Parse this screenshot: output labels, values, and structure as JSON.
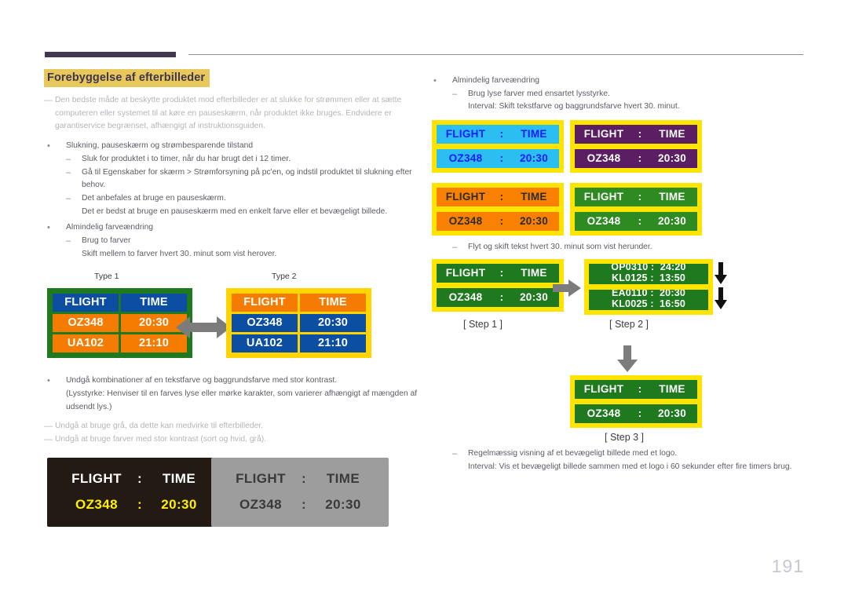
{
  "page": {
    "number": "191"
  },
  "header": {
    "accent_color": "#41374f",
    "rule_color": "#8e8e93"
  },
  "left": {
    "title": "Forebyggelse af efterbilleder",
    "intro": "Den bedste måde at beskytte produktet mod efterbilleder er at slukke for strømmen eller at sætte computeren eller systemet til at køre en pauseskærm, når produktet ikke bruges. Endvidere er garantiservice begrænset, afhængigt af instruktionsguiden.",
    "b1": "Slukning, pauseskærm og strømbesparende tilstand",
    "b1_d1": "Sluk for produktet i to timer, når du har brugt det i 12 timer.",
    "b1_d2": "Gå til Egenskaber for skærm > Strømforsyning på pc'en, og indstil produktet til slukning efter behov.",
    "b1_d3": "Det anbefales at bruge en pauseskærm.",
    "b1_d3_sub": "Det er bedst at bruge en pauseskærm med en enkelt farve eller et bevægeligt billede.",
    "b2": "Almindelig farveændring",
    "b2_d1": "Brug to farver",
    "b2_d1_sub": "Skift mellem to farver hvert 30. minut som vist herover.",
    "type1_label": "Type 1",
    "type2_label": "Type 2",
    "b3": "Undgå kombinationer af en tekstfarve og baggrundsfarve med stor kontrast.",
    "b3_sub": "(Lysstyrke: Henviser til en farves lyse eller mørke karakter, som varierer afhængigt af mængden af udsendt lys.)",
    "n1": "Undgå at bruge grå, da dette kan medvirke til efterbilleder.",
    "n2": "Undgå at bruge farver med stor kontrast (sort og hvid, grå)."
  },
  "right": {
    "b1": "Almindelig farveændring",
    "b1_d1": "Brug lyse farver med ensartet lysstyrke.",
    "b1_d1_sub": "Interval: Skift tekstfarve og baggrundsfarve hvert 30. minut.",
    "b2_d1": "Flyt og skift tekst hvert 30. minut som vist herunder.",
    "step1_label": "[ Step 1 ]",
    "step2_label": "[ Step 2 ]",
    "step3_label": "[ Step 3 ]",
    "b3_d1": "Regelmæssig visning af et bevægeligt billede med et logo.",
    "b3_d1_sub": "Interval: Vis et bevægeligt billede sammen med et logo i 60 sekunder efter fire timers brug."
  },
  "boards": {
    "type1": {
      "frame_color": "#1f7a1f",
      "header_bg": "#0b4ea2",
      "header_fg": "#ffffff",
      "body_bg": "#f57c00",
      "body_fg": "#ffffff",
      "rows": [
        [
          "FLIGHT",
          "TIME"
        ],
        [
          "OZ348",
          "20:30"
        ],
        [
          "UA102",
          "21:10"
        ]
      ]
    },
    "type2": {
      "frame_color": "#ffd400",
      "header_bg": "#f57c00",
      "header_fg": "#ffffff",
      "body_bg": "#0b4ea2",
      "body_fg": "#ffffff",
      "rows": [
        [
          "FLIGHT",
          "TIME"
        ],
        [
          "OZ348",
          "20:30"
        ],
        [
          "UA102",
          "21:10"
        ]
      ]
    },
    "banner_common": {
      "frame_color": "#ffe400",
      "label_flight": "FLIGHT",
      "label_time": "TIME",
      "sep": ":",
      "value_flight": "OZ348",
      "value_time": "20:30"
    },
    "banner_cyan": {
      "bg": "#2bbef0",
      "fg": "#1a1aff"
    },
    "banner_purple": {
      "bg": "#5b1e63",
      "fg": "#ffffff"
    },
    "banner_orange": {
      "bg": "#f98000",
      "fg": "#2b2b2b"
    },
    "banner_green": {
      "bg": "#2e8b22",
      "fg": "#ffffff"
    },
    "banner_step": {
      "bg": "#1f7a1f",
      "fg": "#ffffff"
    },
    "scroll": {
      "frame_color": "#ffe400",
      "window_bg": "#1f7a1f",
      "w1_line1": "OP0310 :  24:20",
      "w1_line2": "KL0125 :  13:50",
      "w2_line1": "EA0110 :  20:30",
      "w2_line2": "KL0025 :  16:50"
    },
    "sample_dark": {
      "bg": "#231a14",
      "head_fg": "#ffffff",
      "value_fg": "#ffef00",
      "label_flight": "FLIGHT",
      "sep": ":",
      "label_time": "TIME",
      "value_flight": "OZ348",
      "value_time": "20:30"
    },
    "sample_gray": {
      "bg": "#9d9d9d",
      "head_fg": "#3a3a3a",
      "value_fg": "#3a3a3a",
      "label_flight": "FLIGHT",
      "sep": ":",
      "label_time": "TIME",
      "value_flight": "OZ348",
      "value_time": "20:30"
    }
  },
  "icons": {
    "double_arrow": "double-arrow-icon",
    "right_arrow": "right-arrow-icon",
    "down_arrow": "down-arrow-icon"
  }
}
